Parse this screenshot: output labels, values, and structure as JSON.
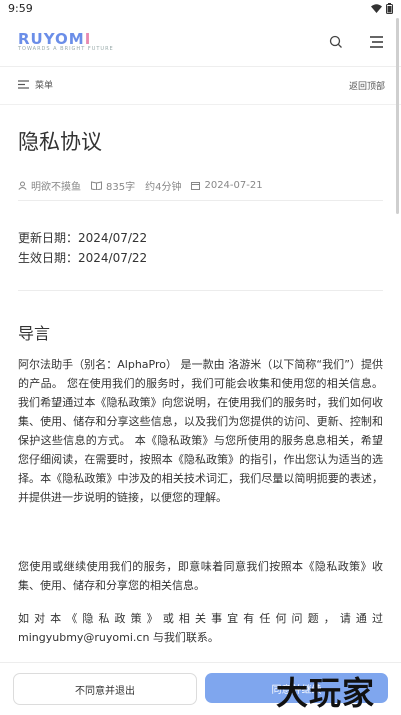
{
  "status_bar": {
    "time": "9:59"
  },
  "header": {
    "logo_text": "RUYOM",
    "logo_text_accent": "I",
    "logo_tagline": "TOWARDS A BRIGHT FUTURE"
  },
  "toolbar": {
    "menu_label": "菜单",
    "back_to_top_label": "返回顶部"
  },
  "article": {
    "title": "隐私协议",
    "author": "明欲不摸鱼",
    "word_count": "835字",
    "read_time": "约4分钟",
    "date": "2024-07-21",
    "updated_date": "更新日期：2024/07/22",
    "effective_date": "生效日期：2024/07/22",
    "section_heading": "导言",
    "paragraphs": [
      "阿尔法助手（别名：AlphaPro） 是一款由 洛游米（以下简称“我们”）提供的产品。 您在使用我们的服务时，我们可能会收集和使用您的相关信息。我们希望通过本《隐私政策》向您说明，在使用我们的服务时，我们如何收集、使用、储存和分享这些信息，以及我们为您提供的访问、更新、控制和保护这些信息的方式。 本《隐私政策》与您所使用的服务息息相关，希望您仔细阅读，在需要时，按照本《隐私政策》的指引，作出您认为适当的选择。本《隐私政策》中涉及的相关技术词汇，我们尽量以简明扼要的表述，并提供进一步说明的链接，以便您的理解。",
      "您使用或继续使用我们的服务，即意味着同意我们按照本《隐私政策》收集、使用、储存和分享您的相关信息。",
      "如对本《隐私政策》或相关事宜有任何问题，请通过 mingyubmy@ruyomi.cn 与我们联系。"
    ]
  },
  "footer": {
    "reject_label": "不同意并退出",
    "agree_label": "同意并继续"
  },
  "watermark": "大玩家",
  "colors": {
    "accent": "#7fa6ee",
    "logo_blue": "#6b8ee8",
    "logo_pink": "#e88ab1"
  }
}
